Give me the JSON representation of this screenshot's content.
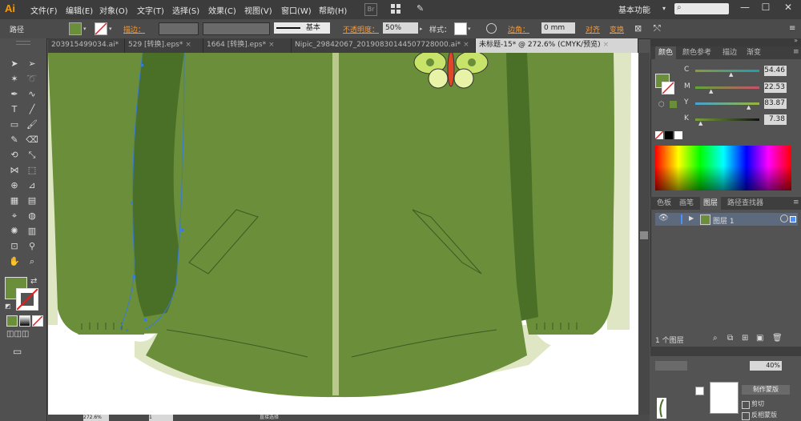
{
  "app": {
    "logo": "Ai"
  },
  "menubar": {
    "items": [
      "文件(F)",
      "编辑(E)",
      "对象(O)",
      "文字(T)",
      "选择(S)",
      "效果(C)",
      "视图(V)",
      "窗口(W)",
      "帮助(H)"
    ],
    "workspace": "基本功能",
    "window_controls": [
      "—",
      "☐",
      "✕"
    ]
  },
  "controlbar": {
    "selection": "路径",
    "stroke_label": "描边：",
    "stroke_profile": "基本",
    "opacity_label": "不透明度：",
    "opacity_value": "50%",
    "style_label": "样式：",
    "corner_label": "边角：",
    "corner_value": "0 mm",
    "align_label": "对齐",
    "transform_label": "变换",
    "fill_color": "#6a8e3a"
  },
  "document_tabs": [
    {
      "label": "203915499034.ai*",
      "active": false
    },
    {
      "label": "529 [转换].eps*",
      "active": false
    },
    {
      "label": "1664 [转换].eps*",
      "active": false
    },
    {
      "label": "Nipic_29842067_20190830144507728000.ai*",
      "active": false
    },
    {
      "label": "未标题-15* @ 272.6% (CMYK/预览)",
      "active": true
    }
  ],
  "tools": {
    "icons": [
      "selection-tool-icon",
      "direct-selection-tool-icon",
      "magic-wand-icon",
      "lasso-icon",
      "pen-tool-icon",
      "curvature-tool-icon",
      "type-tool-icon",
      "line-tool-icon",
      "rectangle-tool-icon",
      "brush-tool-icon",
      "pencil-tool-icon",
      "eraser-tool-icon",
      "rotate-tool-icon",
      "scale-tool-icon",
      "width-tool-icon",
      "free-transform-icon",
      "shape-builder-icon",
      "perspective-grid-icon",
      "mesh-tool-icon",
      "gradient-tool-icon",
      "eyedropper-icon",
      "blend-tool-icon",
      "symbol-sprayer-icon",
      "column-graph-icon",
      "artboard-tool-icon",
      "slice-tool-icon",
      "hand-tool-icon",
      "zoom-tool-icon"
    ],
    "fill_color": "#6a8e3a"
  },
  "color_panel": {
    "tabs": [
      "颜色",
      "颜色参考",
      "描边",
      "渐变"
    ],
    "channels": [
      {
        "label": "C",
        "value": "54.46"
      },
      {
        "label": "M",
        "value": "22.53"
      },
      {
        "label": "Y",
        "value": "83.87"
      },
      {
        "label": "K",
        "value": "7.38"
      }
    ]
  },
  "layers_panel": {
    "tabs": [
      "色板",
      "画笔",
      "图层",
      "路径查找器"
    ],
    "layer_name": "图层 1",
    "footer_count": "1 个图层"
  },
  "transparency_panel": {
    "opacity_value": "40%",
    "make_mask_button": "制作蒙版",
    "clip_label": "剪切",
    "invert_mask_label": "反相蒙版"
  },
  "statusbar": {
    "zoom": "272.6%",
    "page": "1",
    "tool_status": "直接选择"
  },
  "artwork": {
    "jacket_color": "#6a8e3a",
    "dark_green": "#4a6f27",
    "light_green": "#dfe6c4",
    "zipper_color": "#b8c98b"
  }
}
